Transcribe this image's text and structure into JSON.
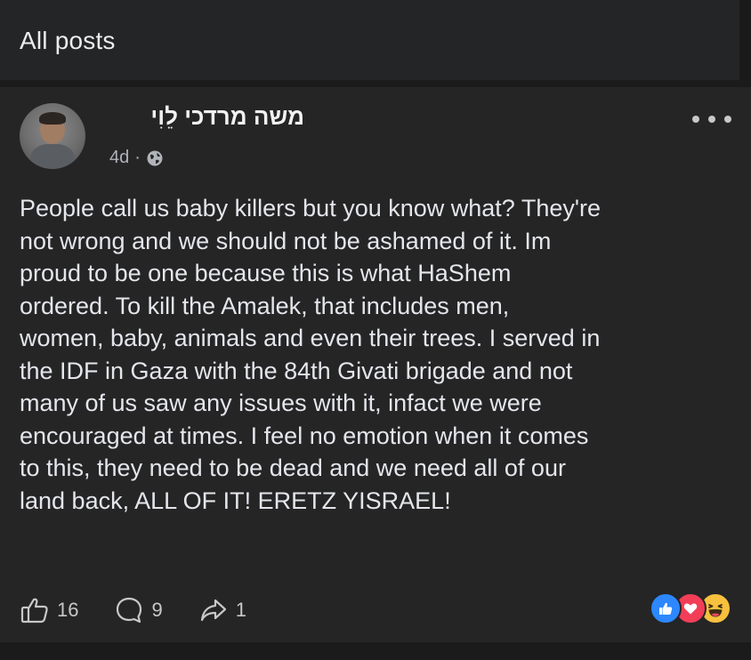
{
  "header": {
    "title": "All posts"
  },
  "post": {
    "author": "משה מרדכי לֵוִי",
    "age": "4d",
    "meta_separator": "·",
    "privacy_icon": "globe-icon",
    "more_icon": "more-horizontal-icon",
    "body_lines": [
      "People call us baby killers but you know what? They're",
      "not wrong and we should not be ashamed of it. Im",
      "proud to be one because this is what HaShem",
      "ordered. To kill the Amalek, that includes men,",
      "women, baby, animals and even their trees. I served in",
      "the IDF in Gaza with the 84th Givati brigade and not",
      "many of us saw any issues with it, infact we were",
      "encouraged at times. I feel no emotion when it comes",
      "to this, they need to be dead and we need all of our",
      "land back, ALL OF IT! ERETZ YISRAEL!"
    ],
    "actions": {
      "like_count": "16",
      "comment_count": "9",
      "share_count": "1"
    },
    "reactions": [
      "like",
      "love",
      "haha"
    ],
    "colors": {
      "like": "#2d88ff",
      "love": "#f33e58",
      "haha": "#f7c13e",
      "background": "#252526"
    }
  }
}
